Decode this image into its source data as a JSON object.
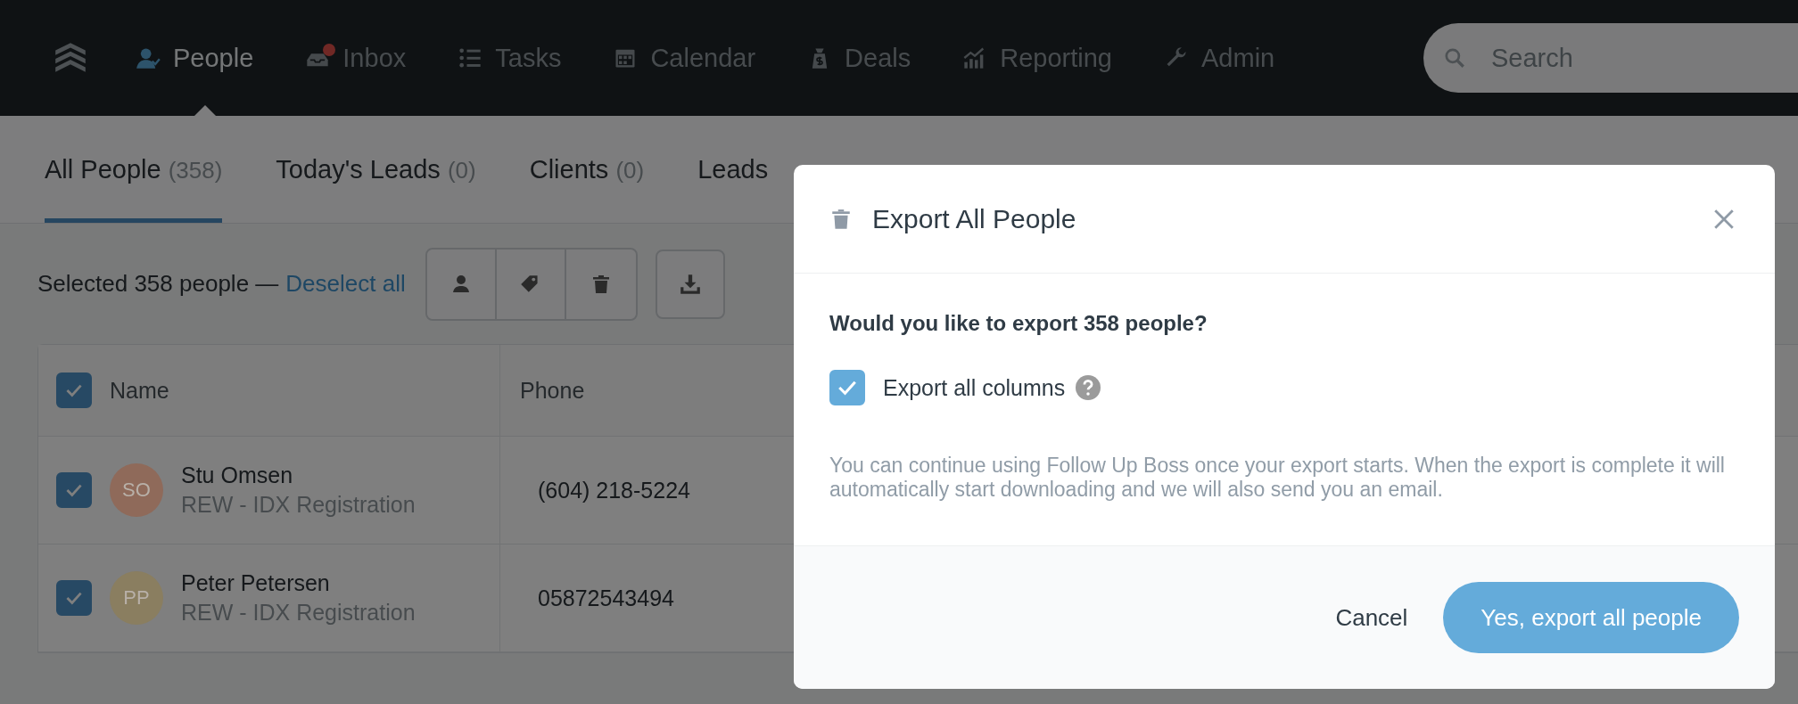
{
  "nav": {
    "items": [
      {
        "label": "People",
        "kind": "people",
        "selected": true,
        "badge": false
      },
      {
        "label": "Inbox",
        "kind": "inbox",
        "selected": false,
        "badge": true
      },
      {
        "label": "Tasks",
        "kind": "tasks",
        "selected": false,
        "badge": false
      },
      {
        "label": "Calendar",
        "kind": "calendar",
        "selected": false,
        "badge": false
      },
      {
        "label": "Deals",
        "kind": "deals",
        "selected": false,
        "badge": false
      },
      {
        "label": "Reporting",
        "kind": "reporting",
        "selected": false,
        "badge": false
      },
      {
        "label": "Admin",
        "kind": "admin",
        "selected": false,
        "badge": false
      }
    ],
    "search": {
      "placeholder": "Search"
    }
  },
  "tabs": [
    {
      "label": "All People",
      "count": "(358)",
      "selected": true
    },
    {
      "label": "Today's Leads",
      "count": "(0)",
      "selected": false
    },
    {
      "label": "Clients",
      "count": "(0)",
      "selected": false
    },
    {
      "label": "Leads",
      "selected": false
    }
  ],
  "selection": {
    "text": "Selected 358 people —",
    "link": "Deselect all"
  },
  "table": {
    "header_checked": true,
    "columns": [
      "Name",
      "Phone"
    ],
    "rows": [
      {
        "checked": true,
        "initials": "SO",
        "color": "#8f6a5a",
        "name": "Stu Omsen",
        "source": "REW - IDX Registration",
        "phone": "(604) 218-5224"
      },
      {
        "checked": true,
        "initials": "PP",
        "color": "#8a7e60",
        "name": "Peter Petersen",
        "source": "REW - IDX Registration",
        "phone": "05872543494"
      }
    ]
  },
  "dialog": {
    "title": "Export All People",
    "question": "Would you like to export 358 people?",
    "option": {
      "label": "Export all columns",
      "checked": true
    },
    "note": "You can continue using Follow Up Boss once your export starts. When the export is complete it will automatically start downloading and we will also send you an email.",
    "cancel": "Cancel",
    "confirm": "Yes, export all people"
  }
}
